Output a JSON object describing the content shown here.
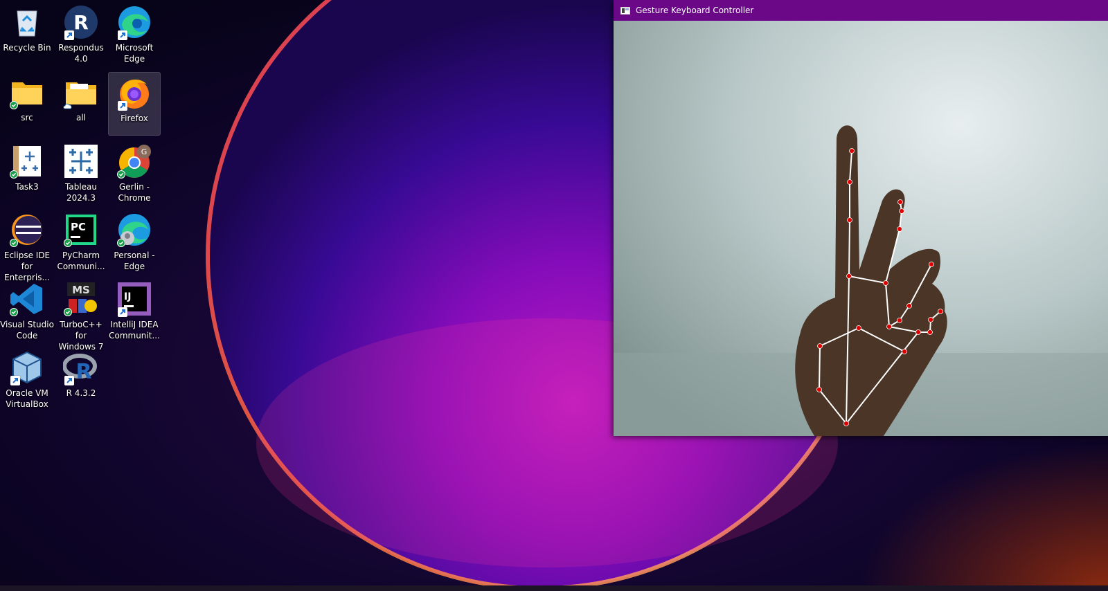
{
  "desktop": {
    "icons": [
      {
        "label": "Recycle Bin",
        "icon": "recycle-bin-icon"
      },
      {
        "label": "Respondus\n4.0",
        "icon": "respondus-icon"
      },
      {
        "label": "Microsoft\nEdge",
        "icon": "edge-icon"
      },
      {
        "label": "src",
        "icon": "folder-icon"
      },
      {
        "label": "all",
        "icon": "folder-icon"
      },
      {
        "label": "Firefox",
        "icon": "firefox-icon"
      },
      {
        "label": "Task3",
        "icon": "tableau-workbook-icon"
      },
      {
        "label": "Tableau\n2024.3",
        "icon": "tableau-icon"
      },
      {
        "label": "Gerlin -\nChrome",
        "icon": "chrome-profile-icon",
        "badge": "G"
      },
      {
        "label": "Eclipse IDE\nfor Enterpris...",
        "icon": "eclipse-icon"
      },
      {
        "label": "PyCharm\nCommuni...",
        "icon": "pycharm-icon",
        "badge": "PC"
      },
      {
        "label": "Personal -\nEdge",
        "icon": "edge-profile-icon"
      },
      {
        "label": "Visual Studio\nCode",
        "icon": "vscode-icon"
      },
      {
        "label": "TurboC++ for\nWindows 7",
        "icon": "turbocpp-icon",
        "badge": "MS"
      },
      {
        "label": "IntelliJ IDEA\nCommunit...",
        "icon": "intellij-icon",
        "badge": "IJ"
      },
      {
        "label": "Oracle VM\nVirtualBox",
        "icon": "virtualbox-icon"
      },
      {
        "label": "R 4.3.2",
        "icon": "r-icon"
      }
    ]
  },
  "window": {
    "title": "Gesture Keyboard Controller",
    "titlebar_color": "#6a0888"
  },
  "colors": {
    "landmark": "#e00000",
    "connection": "#ffffff"
  }
}
